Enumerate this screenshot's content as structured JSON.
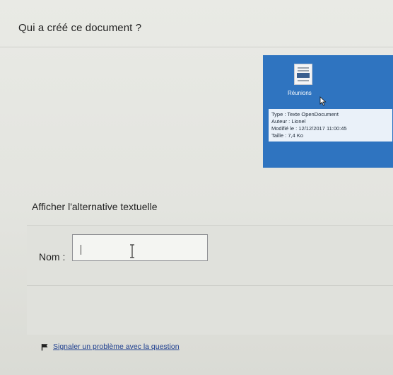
{
  "question": {
    "text": "Qui a créé ce document ?"
  },
  "tooltip": {
    "file_name": "Réunions",
    "type_line": "Type : Texte OpenDocument",
    "author_line": "Auteur : Lionel",
    "modified_line": "Modifié le : 12/12/2017 11:00:45",
    "size_line": "Taille : 7,4 Ko",
    "panel_color": "#2f74c0"
  },
  "alt_text": {
    "label": "Afficher l'alternative textuelle"
  },
  "answer": {
    "label": "Nom :",
    "value": ""
  },
  "report": {
    "label": "Signaler un problème avec la question",
    "link_color": "#1f3f8f"
  },
  "icons": {
    "document": "document-icon",
    "pointer": "mouse-pointer-icon",
    "text_cursor": "ibeam-cursor-icon",
    "flag": "flag-icon"
  }
}
